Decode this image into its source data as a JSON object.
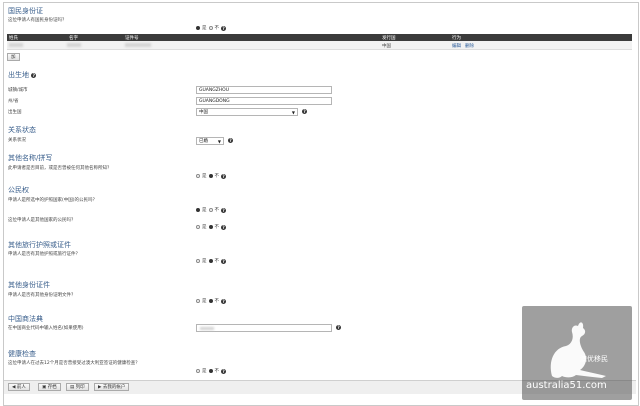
{
  "sections": {
    "national_id": {
      "title": "国民身份证",
      "question": "这位申请人有国民身份证吗？",
      "yes": "是",
      "no": "不",
      "table_headers": [
        "姓氏",
        "名字",
        "证件号",
        "",
        "",
        "",
        "",
        "",
        "发行国",
        "行为"
      ],
      "row": {
        "country": "中国",
        "edit": "编辑",
        "delete": "删除"
      },
      "add_button": "加"
    },
    "birthplace": {
      "title": "出生地",
      "city_label": "城镇/城市",
      "city_value": "GUANGZHOU",
      "province_label": "州/省",
      "province_value": "GUANGDONG",
      "country_label": "出生国",
      "country_value": "中国"
    },
    "relationship": {
      "title": "关系状态",
      "label": "关系状况",
      "value": "已婚"
    },
    "other_names": {
      "title": "其他名称/拼写",
      "question": "此申请者是否目前，或是否曾被任何其他名称所知？",
      "yes": "是",
      "no": "不"
    },
    "citizenship": {
      "title": "公民权",
      "q1": "申请人是所选中的护照国家(中国)的公民吗？",
      "q2": "这位申请人是其他国家的公民吗？",
      "yes": "是",
      "no": "不"
    },
    "other_passports": {
      "title": "其他旅行护照或证件",
      "question": "申请人是否有其他护照或旅行证件？",
      "yes": "是",
      "no": "不"
    },
    "other_id": {
      "title": "其他身份证件",
      "question": "申请人是否有其他身份证明文件？",
      "yes": "是",
      "no": "不"
    },
    "chinese_code": {
      "title": "中国商法典",
      "label": "在中国商业代码中输入姓名(如果使用)"
    },
    "health": {
      "title": "健康检查",
      "question": "这位申请人在过去12个月是否曾接受过澳大利亚签证的健康检查？",
      "yes": "是",
      "no": "不"
    }
  },
  "footer": {
    "prev": "前人",
    "save": "存档",
    "print": "列印",
    "account": "去我的帐户"
  },
  "watermark": {
    "text1": "澳优移民",
    "text2": "australia51.com"
  },
  "colors": {
    "heading": "#3a5f8c",
    "table_header": "#3b3b3b",
    "watermark": "#505050"
  }
}
